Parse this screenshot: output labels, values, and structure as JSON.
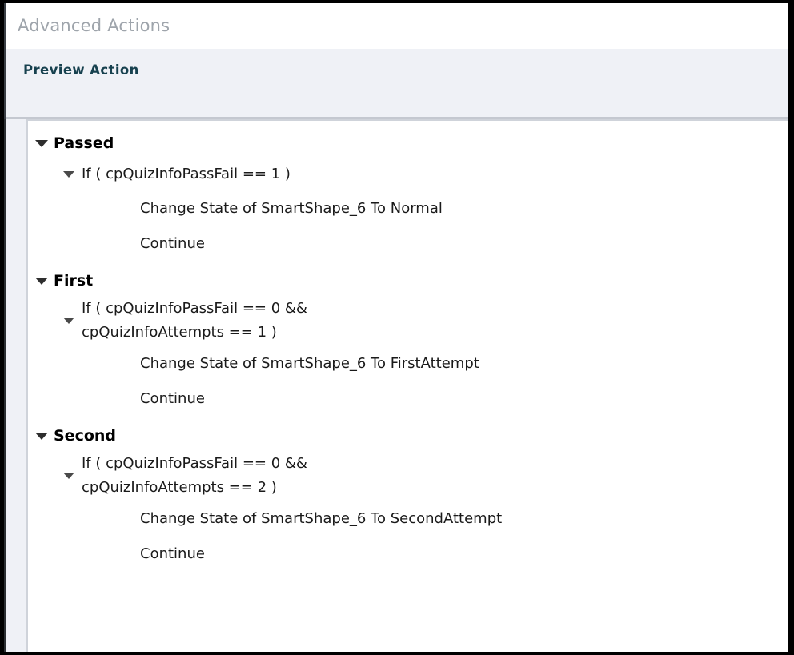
{
  "window": {
    "title": "Advanced Actions",
    "frame_color": "#000000",
    "title_color": "#9ea4ab"
  },
  "section": {
    "title": "Preview Action",
    "title_color": "#17414f",
    "background": "#eff1f6"
  },
  "icons": {
    "expanded_triangle": "triangle-down-icon"
  },
  "tree": {
    "groups": [
      {
        "name": "Passed",
        "expanded": true,
        "condition": "If ( cpQuizInfoPassFail == 1  )",
        "condition_expanded": true,
        "actions": [
          "Change State of SmartShape_6 To Normal",
          "Continue"
        ]
      },
      {
        "name": "First",
        "expanded": true,
        "condition": "If ( cpQuizInfoPassFail == 0 &&\ncpQuizInfoAttempts == 1  )",
        "condition_expanded": true,
        "actions": [
          "Change State of SmartShape_6 To FirstAttempt",
          "Continue"
        ]
      },
      {
        "name": "Second",
        "expanded": true,
        "condition": "If ( cpQuizInfoPassFail == 0 &&\ncpQuizInfoAttempts == 2  )",
        "condition_expanded": true,
        "actions": [
          "Change State of SmartShape_6 To SecondAttempt",
          "Continue"
        ]
      }
    ]
  }
}
